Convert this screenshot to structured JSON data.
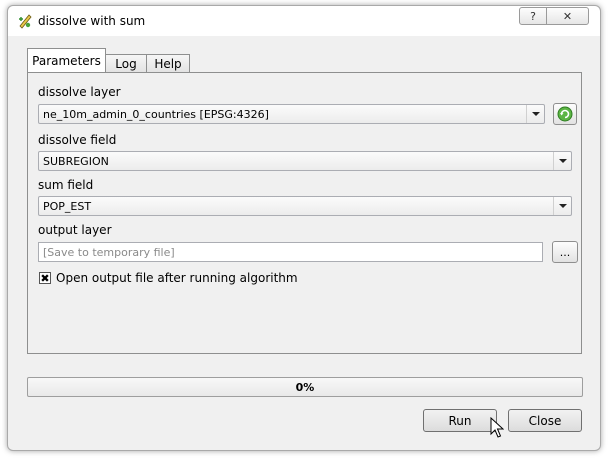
{
  "window": {
    "title": "dissolve with sum",
    "help_glyph": "?",
    "close_glyph": "✕",
    "icons": {
      "app": "qgis-script-icon",
      "help": "help-icon",
      "close": "close-icon"
    }
  },
  "tabs": [
    {
      "label": "Parameters",
      "active": true
    },
    {
      "label": "Log",
      "active": false
    },
    {
      "label": "Help",
      "active": false
    }
  ],
  "params": {
    "dissolve_layer": {
      "label": "dissolve layer",
      "value": "ne_10m_admin_0_countries [EPSG:4326]",
      "refresh_icon": "refresh-icon"
    },
    "dissolve_field": {
      "label": "dissolve field",
      "value": "SUBREGION"
    },
    "sum_field": {
      "label": "sum field",
      "value": "POP_EST"
    },
    "output_layer": {
      "label": "output layer",
      "placeholder": "[Save to temporary file]",
      "value": "",
      "browse_label": "..."
    },
    "open_output": {
      "label": "Open output file after running algorithm",
      "checked": true,
      "check_glyph": "✖"
    }
  },
  "progress": {
    "value": 0,
    "text": "0%"
  },
  "buttons": {
    "run": "Run",
    "close": "Close"
  },
  "colors": {
    "accent_green": "#3a9b2a",
    "progress_fill": "#6ccf4e"
  }
}
